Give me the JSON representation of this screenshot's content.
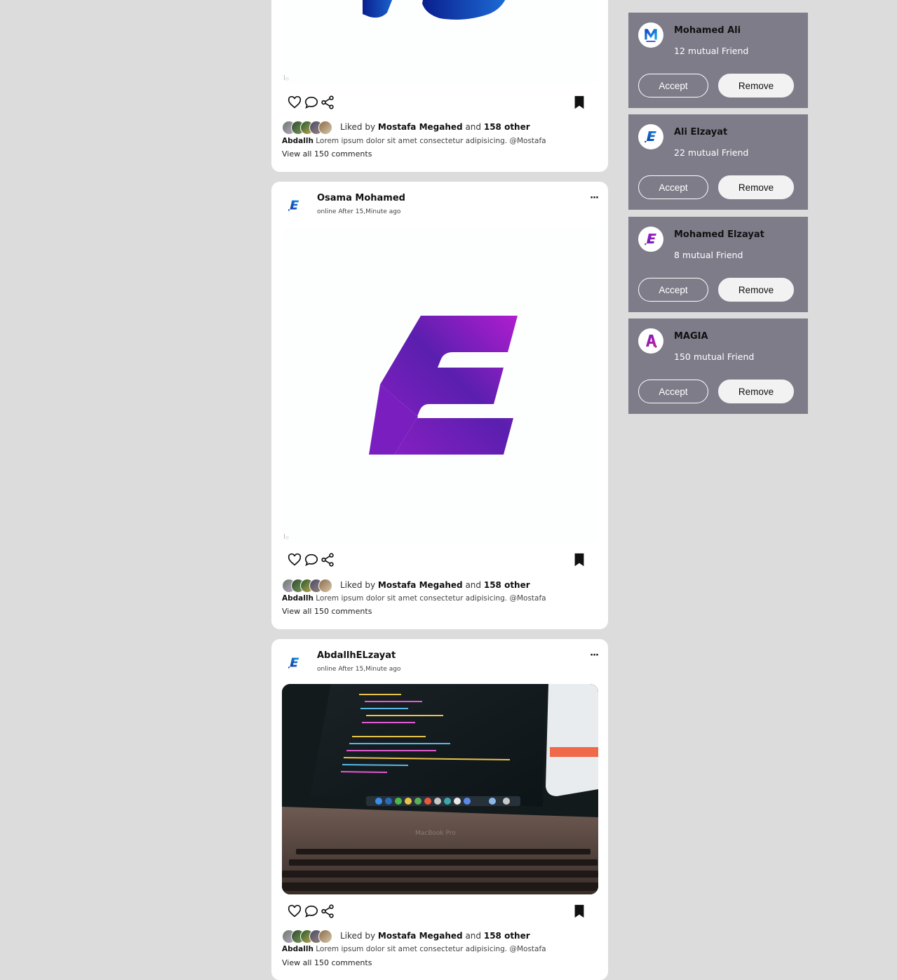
{
  "posts": [
    {
      "author": "",
      "time": "",
      "likes_prefix": "Liked by",
      "liked_by": "Mostafa Megahed",
      "and_text": "and",
      "others": "158 other",
      "caption_author": "Abdallh",
      "caption_text": "Lorem ipsum dolor sit amet consectetur adipisicing. @Mostafa",
      "view_comments": "View all 150 comments"
    },
    {
      "author": "Osama Mohamed",
      "time": "online After 15,Minute ago",
      "likes_prefix": "Liked by",
      "liked_by": "Mostafa Megahed",
      "and_text": "and",
      "others": "158 other",
      "caption_author": "Abdallh",
      "caption_text": "Lorem ipsum dolor sit amet consectetur adipisicing. @Mostafa",
      "view_comments": "View all 150 comments"
    },
    {
      "author": "AbdallhELzayat",
      "time": "online After 15,Minute ago",
      "likes_prefix": "Liked by",
      "liked_by": "Mostafa Megahed",
      "and_text": "and",
      "others": "158 other",
      "caption_author": "Abdallh",
      "caption_text": "Lorem ipsum dolor sit amet consectetur adipisicing. @Mostafa",
      "view_comments": "View all 150 comments"
    }
  ],
  "more_label": "···",
  "suggestions": [
    {
      "name": "Mohamed Ali",
      "mutual": "12 mutual Friend",
      "accept": "Accept",
      "remove": "Remove"
    },
    {
      "name": "Ali Elzayat",
      "mutual": "22 mutual Friend",
      "accept": "Accept",
      "remove": "Remove"
    },
    {
      "name": "Mohamed Elzayat",
      "mutual": "8 mutual Friend",
      "accept": "Accept",
      "remove": "Remove"
    },
    {
      "name": "MAGIA",
      "mutual": "150 mutual Friend",
      "accept": "Accept",
      "remove": "Remove"
    }
  ],
  "icons": {
    "like": "heart-icon",
    "comment": "comment-icon",
    "share": "share-icon",
    "save": "bookmark-icon",
    "more": "more-dots-icon"
  },
  "colors": {
    "page_bg": "#dcdcdc",
    "card_bg": "#ffffff",
    "suggestion_bg": "#7f7c89",
    "logo_purple": "#7b22c4",
    "logo_blue": "#1c4fb8"
  }
}
